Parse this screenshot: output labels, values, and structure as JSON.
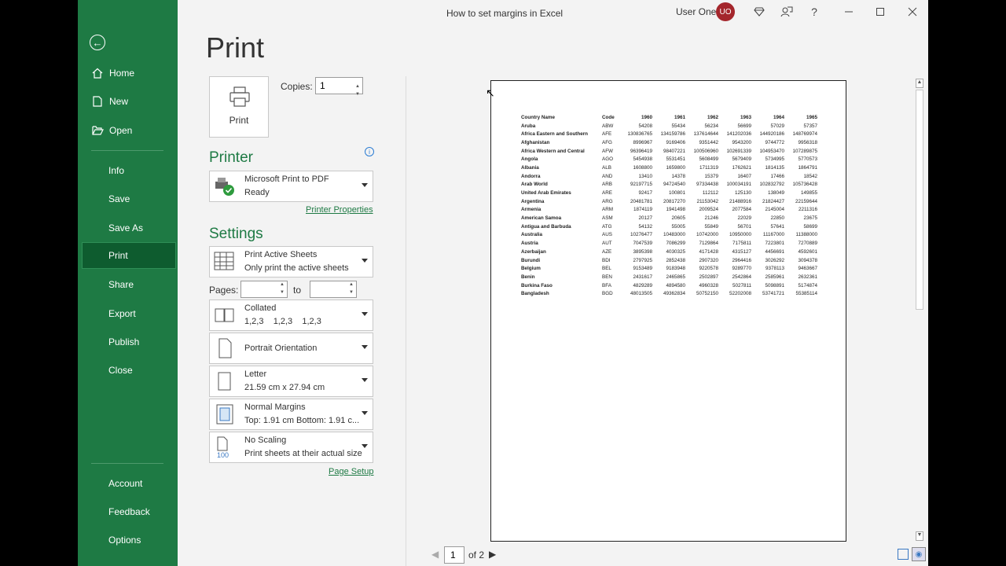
{
  "window": {
    "title": "How to set margins in Excel",
    "user_name": "User One",
    "user_initials": "UO"
  },
  "sidebar": {
    "items": [
      {
        "label": "Home",
        "icon": "home-icon"
      },
      {
        "label": "New",
        "icon": "new-document-icon"
      },
      {
        "label": "Open",
        "icon": "folder-open-icon"
      },
      {
        "label": "Info"
      },
      {
        "label": "Save"
      },
      {
        "label": "Save As"
      },
      {
        "label": "Print",
        "active": true
      },
      {
        "label": "Share"
      },
      {
        "label": "Export"
      },
      {
        "label": "Publish"
      },
      {
        "label": "Close"
      }
    ],
    "bottom_items": [
      {
        "label": "Account"
      },
      {
        "label": "Feedback"
      },
      {
        "label": "Options"
      }
    ]
  },
  "print": {
    "heading": "Print",
    "print_button_label": "Print",
    "copies_label": "Copies:",
    "copies_value": "1"
  },
  "printer": {
    "heading": "Printer",
    "name": "Microsoft Print to PDF",
    "status": "Ready",
    "properties_link": "Printer Properties"
  },
  "settings": {
    "heading": "Settings",
    "what_to_print": {
      "title": "Print Active Sheets",
      "subtitle": "Only print the active sheets"
    },
    "pages_label": "Pages:",
    "to_label": "to",
    "collation": {
      "title": "Collated",
      "subtitle": "1,2,3    1,2,3    1,2,3"
    },
    "orientation": {
      "title": "Portrait Orientation"
    },
    "paper": {
      "title": "Letter",
      "subtitle": "21.59 cm x 27.94 cm"
    },
    "margins": {
      "title": "Normal Margins",
      "subtitle": "Top: 1.91 cm Bottom: 1.91 c..."
    },
    "scaling": {
      "title": "No Scaling",
      "subtitle": "Print sheets at their actual size",
      "icon_text": "100"
    },
    "page_setup_link": "Page Setup"
  },
  "preview": {
    "current_page": "1",
    "of_pages": "of 2",
    "headers": [
      "Country Name",
      "Code",
      "1960",
      "1961",
      "1962",
      "1963",
      "1964",
      "1965"
    ],
    "rows": [
      [
        "Aruba",
        "ABW",
        "54208",
        "55434",
        "56234",
        "56699",
        "57029",
        "57357"
      ],
      [
        "Africa Eastern and Southern",
        "AFE",
        "130836765",
        "134159786",
        "137614644",
        "141202036",
        "144920186",
        "148769974"
      ],
      [
        "Afghanistan",
        "AFG",
        "8996967",
        "9169406",
        "9351442",
        "9543200",
        "9744772",
        "9956318"
      ],
      [
        "Africa Western and Central",
        "AFW",
        "96396419",
        "98407221",
        "100506960",
        "102691339",
        "104953470",
        "107289875"
      ],
      [
        "Angola",
        "AGO",
        "5454938",
        "5531451",
        "5608499",
        "5679409",
        "5734995",
        "5770573"
      ],
      [
        "Albania",
        "ALB",
        "1608800",
        "1659800",
        "1711319",
        "1762621",
        "1814135",
        "1864791"
      ],
      [
        "Andorra",
        "AND",
        "13410",
        "14378",
        "15379",
        "16407",
        "17466",
        "18542"
      ],
      [
        "Arab World",
        "ARB",
        "92197715",
        "94724540",
        "97334438",
        "100034191",
        "102832792",
        "105736428"
      ],
      [
        "United Arab Emirates",
        "ARE",
        "92417",
        "100801",
        "112112",
        "125130",
        "138049",
        "149855"
      ],
      [
        "Argentina",
        "ARG",
        "20481781",
        "20817270",
        "21153042",
        "21488916",
        "21824427",
        "22159644"
      ],
      [
        "Armenia",
        "ARM",
        "1874119",
        "1941498",
        "2009524",
        "2077584",
        "2145004",
        "2211316"
      ],
      [
        "American Samoa",
        "ASM",
        "20127",
        "20605",
        "21246",
        "22029",
        "22850",
        "23675"
      ],
      [
        "Antigua and Barbuda",
        "ATG",
        "54132",
        "55005",
        "55849",
        "56701",
        "57641",
        "58699"
      ],
      [
        "Australia",
        "AUS",
        "10276477",
        "10483000",
        "10742000",
        "10950000",
        "11167000",
        "11388000"
      ],
      [
        "Austria",
        "AUT",
        "7047539",
        "7086299",
        "7129864",
        "7175811",
        "7223801",
        "7270889"
      ],
      [
        "Azerbaijan",
        "AZE",
        "3895398",
        "4030325",
        "4171428",
        "4315127",
        "4456691",
        "4592601"
      ],
      [
        "Burundi",
        "BDI",
        "2797925",
        "2852438",
        "2907320",
        "2964416",
        "3026292",
        "3094378"
      ],
      [
        "Belgium",
        "BEL",
        "9153489",
        "9183948",
        "9220578",
        "9289770",
        "9378113",
        "9463667"
      ],
      [
        "Benin",
        "BEN",
        "2431617",
        "2465865",
        "2502897",
        "2542864",
        "2585961",
        "2632361"
      ],
      [
        "Burkina Faso",
        "BFA",
        "4829289",
        "4894580",
        "4960328",
        "5027811",
        "5098891",
        "5174874"
      ],
      [
        "Bangladesh",
        "BGD",
        "48013505",
        "49362834",
        "50752150",
        "52202008",
        "53741721",
        "55385114"
      ]
    ]
  },
  "colors": {
    "sidebar_bg": "#1e7a44",
    "sidebar_active": "#0e5c2f",
    "accent": "#1e7a44",
    "avatar_bg": "#a4262c"
  }
}
